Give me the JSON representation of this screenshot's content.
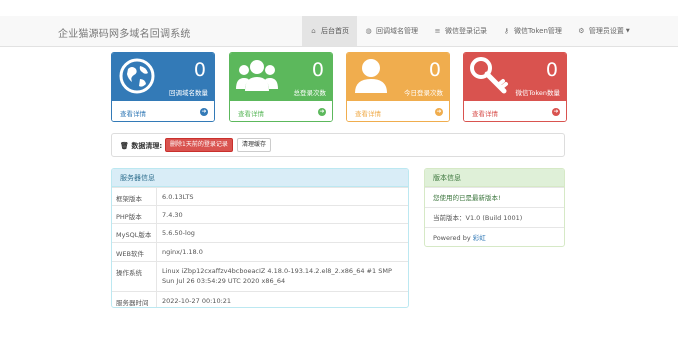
{
  "brand": "企业猫源码网多域名回调系统",
  "nav": {
    "items": [
      {
        "label": "后台首页",
        "icon": "home-icon"
      },
      {
        "label": "回调域名管理",
        "icon": "globe-icon"
      },
      {
        "label": "微信登录记录",
        "icon": "list-icon"
      },
      {
        "label": "微信Token管理",
        "icon": "key-icon"
      },
      {
        "label": "管理员设置",
        "icon": "gear-icon"
      }
    ]
  },
  "cards": [
    {
      "value": "0",
      "label": "回调域名数量",
      "link": "查看详情",
      "color": "#337ab7",
      "icon": "globe-icon"
    },
    {
      "value": "0",
      "label": "总登录次数",
      "link": "查看详情",
      "color": "#5cb85c",
      "icon": "users-icon"
    },
    {
      "value": "0",
      "label": "今日登录次数",
      "link": "查看详情",
      "color": "#f0ad4e",
      "icon": "user-icon"
    },
    {
      "value": "0",
      "label": "微信Token数量",
      "link": "查看详情",
      "color": "#d9534f",
      "icon": "key-icon"
    }
  ],
  "clean": {
    "title": "数据清理:",
    "delete_label": "删除1天前的登录记录",
    "cache_label": "清理缓存"
  },
  "server": {
    "title": "服务器信息",
    "rows": [
      {
        "key": "框架版本",
        "value": "6.0.13LTS"
      },
      {
        "key": "PHP版本",
        "value": "7.4.30"
      },
      {
        "key": "MySQL版本",
        "value": "5.6.50-log"
      },
      {
        "key": "WEB软件",
        "value": "nginx/1.18.0"
      },
      {
        "key": "操作系统",
        "value": "Linux iZbp12cxaffzv4bcboeacIZ 4.18.0-193.14.2.el8_2.x86_64 #1 SMP Sun Jul 26 03:54:29 UTC 2020 x86_64"
      },
      {
        "key": "服务器时间",
        "value": "2022-10-27 00:10:21"
      }
    ]
  },
  "version": {
    "title": "版本信息",
    "latest": "您使用的已是最新版本!",
    "current": "当前版本：V1.0 (Build 1001)",
    "powered_prefix": "Powered by",
    "powered_link": "彩虹"
  }
}
